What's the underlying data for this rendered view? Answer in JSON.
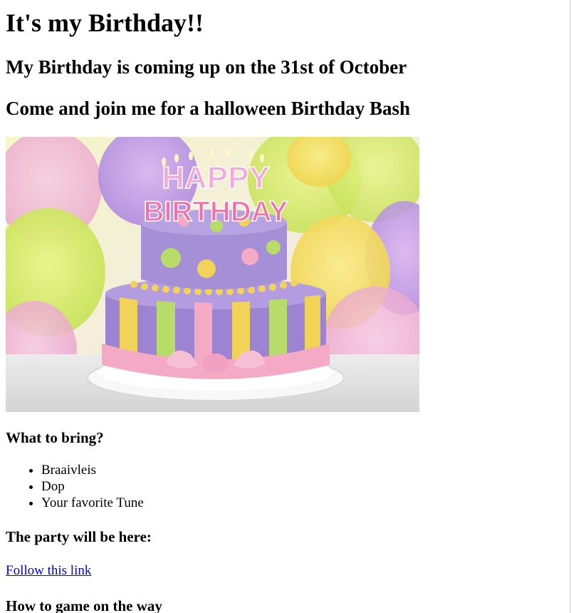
{
  "page": {
    "title": "It's my Birthday!!",
    "subtitle_date": "My Birthday is coming up on the 31st of October",
    "subtitle_invite": "Come and join me for a halloween Birthday Bash"
  },
  "cake_image": {
    "candle_text_top": "HAPPY",
    "candle_text_bottom": "BIRTHDAY",
    "colors": {
      "cake_top": "#a58fd6",
      "cake_bottom": "#9c84d2",
      "ribbon_pink": "#f4a9c4",
      "yellow_stripe": "#f2d35a",
      "green_stripe": "#b8dc6a"
    }
  },
  "bring": {
    "heading": "What to bring?",
    "items": [
      "Braaivleis",
      "Dop",
      "Your favorite Tune"
    ]
  },
  "location": {
    "heading": "The party will be here:",
    "link_text": "Follow this link"
  },
  "next_heading": "How to game on the way"
}
